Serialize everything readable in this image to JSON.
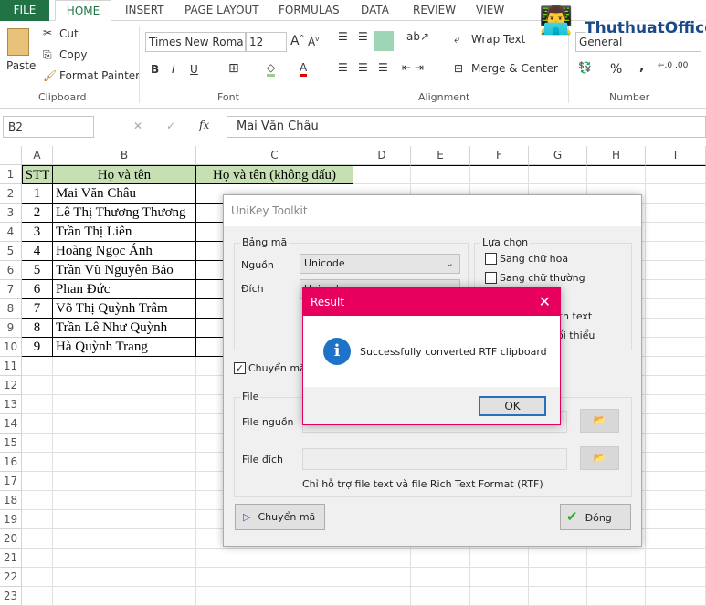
{
  "ribbon": {
    "tabs": [
      "FILE",
      "HOME",
      "INSERT",
      "PAGE LAYOUT",
      "FORMULAS",
      "DATA",
      "REVIEW",
      "VIEW"
    ],
    "clipboard": {
      "paste": "Paste",
      "cut": "Cut",
      "copy": "Copy",
      "format_painter": "Format Painter",
      "label": "Clipboard"
    },
    "font": {
      "name": "Times New Roma",
      "size": "12",
      "label": "Font",
      "bold": "B",
      "italic": "I",
      "underline": "U"
    },
    "alignment": {
      "wrap_text": "Wrap Text",
      "merge_center": "Merge & Center",
      "label": "Alignment"
    },
    "number": {
      "format": "General",
      "label": "Number",
      "percent": "%",
      "comma": ","
    }
  },
  "watermark": "ThuthuatOffice",
  "formula_bar": {
    "name_box": "B2",
    "fx": "fx",
    "value": "Mai Văn Châu"
  },
  "columns": [
    "A",
    "B",
    "C",
    "D",
    "E",
    "F",
    "G",
    "H",
    "I"
  ],
  "rows": [
    "1",
    "2",
    "3",
    "4",
    "5",
    "6",
    "7",
    "8",
    "9",
    "10",
    "11",
    "12",
    "13",
    "14",
    "15",
    "16",
    "17",
    "18",
    "19",
    "20",
    "21",
    "22",
    "23"
  ],
  "table": {
    "headers": [
      "STT",
      "Họ và tên",
      "Họ và tên (không dấu)"
    ],
    "data": [
      [
        "1",
        "Mai Văn Châu"
      ],
      [
        "2",
        "Lê Thị Thương Thương"
      ],
      [
        "3",
        "Trần Thị Liên"
      ],
      [
        "4",
        "Hoàng Ngọc Ánh"
      ],
      [
        "5",
        "Trần Vũ Nguyên Bảo"
      ],
      [
        "6",
        "Phan Đức"
      ],
      [
        "7",
        "Võ Thị Quỳnh Trâm"
      ],
      [
        "8",
        "Trần Lê Như Quỳnh"
      ],
      [
        "9",
        "Hà Quỳnh Trang"
      ]
    ]
  },
  "unikey": {
    "title": "UniKey Toolkit",
    "bang_ma": "Bảng mã",
    "nguon": "Nguồn",
    "nguon_value": "Unicode",
    "dich": "Đích",
    "dich_value": "Unicode",
    "lua_chon": "Lựa chọn",
    "opt_upper": "Sang chữ hoa",
    "opt_lower": "Sang chữ thường",
    "opt3_partial": "ch text",
    "opt4_partial": "ối thiểu",
    "clipboard_check_partial": "Chuyển mã c",
    "clipboard_checked": true,
    "file": "File",
    "file_nguon": "File nguồn",
    "file_dich": "File đích",
    "note": "Chỉ hỗ trợ file text và file Rich Text Format (RTF)",
    "convert_btn": "Chuyển mã",
    "close_btn": "Đóng"
  },
  "result": {
    "title": "Result",
    "message": "Successfully converted RTF clipboard",
    "ok": "OK",
    "accent": "#e8005f"
  }
}
